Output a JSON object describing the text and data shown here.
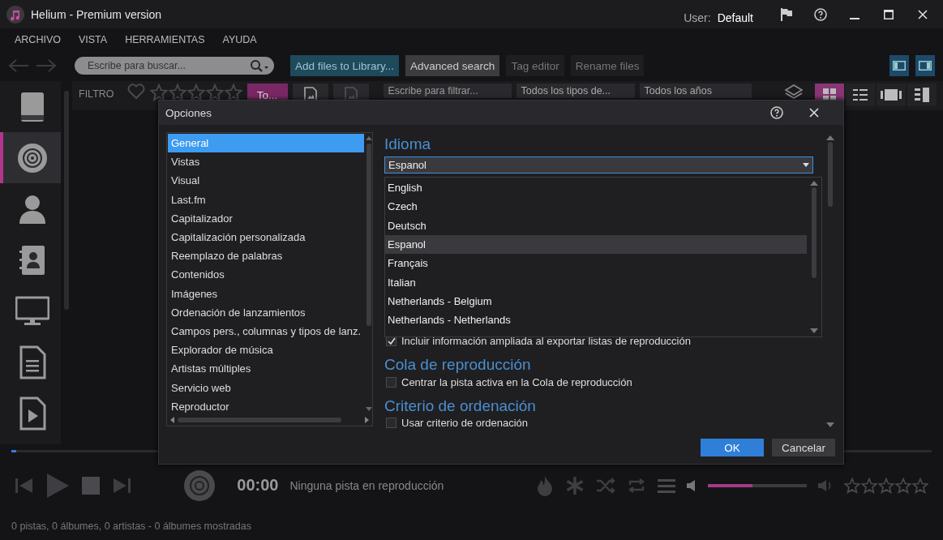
{
  "window": {
    "title": "Helium - Premium version",
    "user_label": "User:",
    "user_name": "Default"
  },
  "menu": [
    "ARCHIVO",
    "VISTA",
    "HERRAMIENTAS",
    "AYUDA"
  ],
  "toolbar": {
    "search": {
      "placeholder": "Escribe para buscar..."
    },
    "buttons": [
      {
        "label": "Add files to Library...",
        "kind": "accent",
        "disabled": false
      },
      {
        "label": "Advanced search",
        "kind": "normal",
        "disabled": false
      },
      {
        "label": "Tag editor",
        "kind": "normal",
        "disabled": true
      },
      {
        "label": "Rename files",
        "kind": "normal",
        "disabled": true
      }
    ],
    "panes": [
      {
        "kind": "left",
        "selected": true
      },
      {
        "kind": "right",
        "selected": true
      }
    ]
  },
  "filter_bar": {
    "label": "FILTRO",
    "stars": 0,
    "tab": {
      "label": "To...",
      "selected": true
    },
    "filter": {
      "placeholder": "Escribe para filtrar..."
    },
    "type_select": "Todos los tipos de...",
    "year_select": "Todos los años",
    "views": [
      {
        "kind": "grid",
        "selected": true
      },
      {
        "kind": "list",
        "selected": false
      },
      {
        "kind": "film",
        "selected": false
      },
      {
        "kind": "columns",
        "selected": false
      }
    ]
  },
  "sidebar": {
    "items": [
      {
        "kind": "book",
        "selected": false
      },
      {
        "kind": "disc",
        "selected": true
      },
      {
        "kind": "person",
        "selected": false
      },
      {
        "kind": "contacts",
        "selected": false
      },
      {
        "kind": "monitor",
        "selected": false
      },
      {
        "kind": "document",
        "selected": false
      },
      {
        "kind": "video",
        "selected": false
      }
    ]
  },
  "dialog": {
    "title": "Opciones",
    "categories": [
      {
        "label": "General",
        "selected": true
      },
      {
        "label": "Vistas",
        "selected": false
      },
      {
        "label": "Visual",
        "selected": false
      },
      {
        "label": "Last.fm",
        "selected": false
      },
      {
        "label": "Capitalizador",
        "selected": false
      },
      {
        "label": "Capitalización personalizada",
        "selected": false
      },
      {
        "label": "Reemplazo de palabras",
        "selected": false
      },
      {
        "label": "Contenidos",
        "selected": false
      },
      {
        "label": "Imágenes",
        "selected": false
      },
      {
        "label": "Ordenación de lanzamientos",
        "selected": false
      },
      {
        "label": "Campos pers., columnas y tipos de lanz.",
        "selected": false
      },
      {
        "label": "Explorador de música",
        "selected": false
      },
      {
        "label": "Artistas múltiples",
        "selected": false
      },
      {
        "label": "Servicio web",
        "selected": false
      },
      {
        "label": "Reproductor",
        "selected": false
      }
    ],
    "language": {
      "heading": "Idioma",
      "value": "Espanol",
      "expanded": true,
      "options": [
        {
          "label": "English",
          "selected": false
        },
        {
          "label": "Czech",
          "selected": false
        },
        {
          "label": "Deutsch",
          "selected": false
        },
        {
          "label": "Espanol",
          "selected": true
        },
        {
          "label": "Français",
          "selected": false
        },
        {
          "label": "Italian",
          "selected": false
        },
        {
          "label": "Netherlands - Belgium",
          "selected": false
        },
        {
          "label": "Netherlands - Netherlands",
          "selected": false
        }
      ]
    },
    "settings": [
      {
        "kind": "check",
        "label": "Incluir información ampliada al exportar listas de reproducción",
        "checked": true
      },
      {
        "kind": "heading",
        "label": "Cola de reproducción"
      },
      {
        "kind": "check",
        "label": "Centrar la pista activa en la Cola de reproducción",
        "checked": false
      },
      {
        "kind": "heading",
        "label": "Criterio de ordenación"
      },
      {
        "kind": "check",
        "label": "Usar criterio de ordenación",
        "checked": false
      }
    ],
    "buttons": [
      {
        "label": "OK",
        "kind": "primary"
      },
      {
        "label": "Cancelar",
        "kind": "secondary"
      }
    ]
  },
  "player": {
    "progress": {
      "level": 0.005
    },
    "time": "00:00",
    "track": "Ninguna pista en reproducción",
    "volume": {
      "level": 0.45
    },
    "rating": {
      "stars": 0
    }
  },
  "status_bar": "0 pistas, 0 álbumes, 0 artistas - 0 álbumes mostradas"
}
